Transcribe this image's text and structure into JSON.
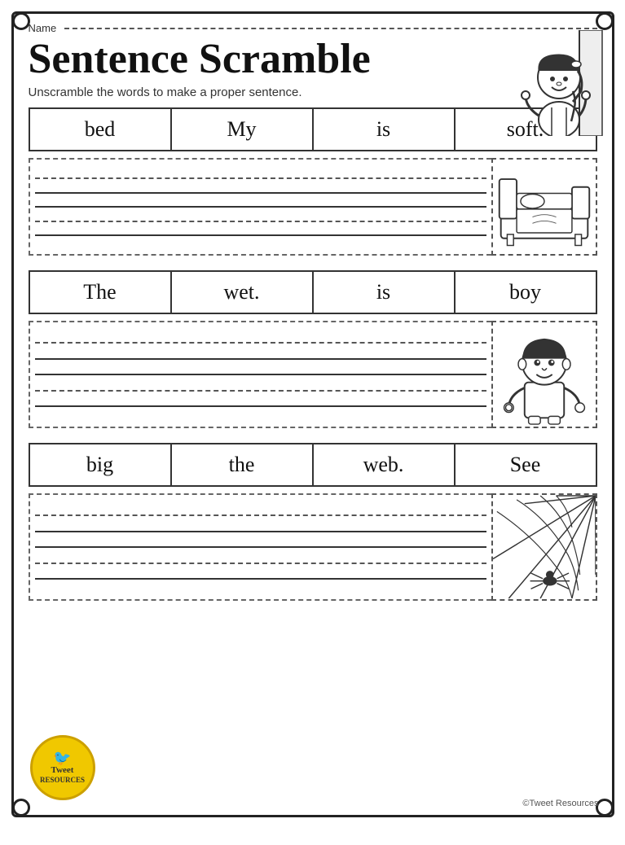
{
  "page": {
    "name_label": "Name",
    "title": "Sentence Scramble",
    "subtitle": "Unscramble the words to make a proper sentence.",
    "sentences": [
      {
        "id": "sentence-1",
        "words": [
          "bed",
          "My",
          "is",
          "soft."
        ]
      },
      {
        "id": "sentence-2",
        "words": [
          "The",
          "wet.",
          "is",
          "boy"
        ]
      },
      {
        "id": "sentence-3",
        "words": [
          "big",
          "the",
          "web.",
          "See"
        ]
      }
    ],
    "logo": {
      "line1": "Tweet",
      "line2": "RESOURCES"
    },
    "copyright": "©Tweet Resources"
  }
}
